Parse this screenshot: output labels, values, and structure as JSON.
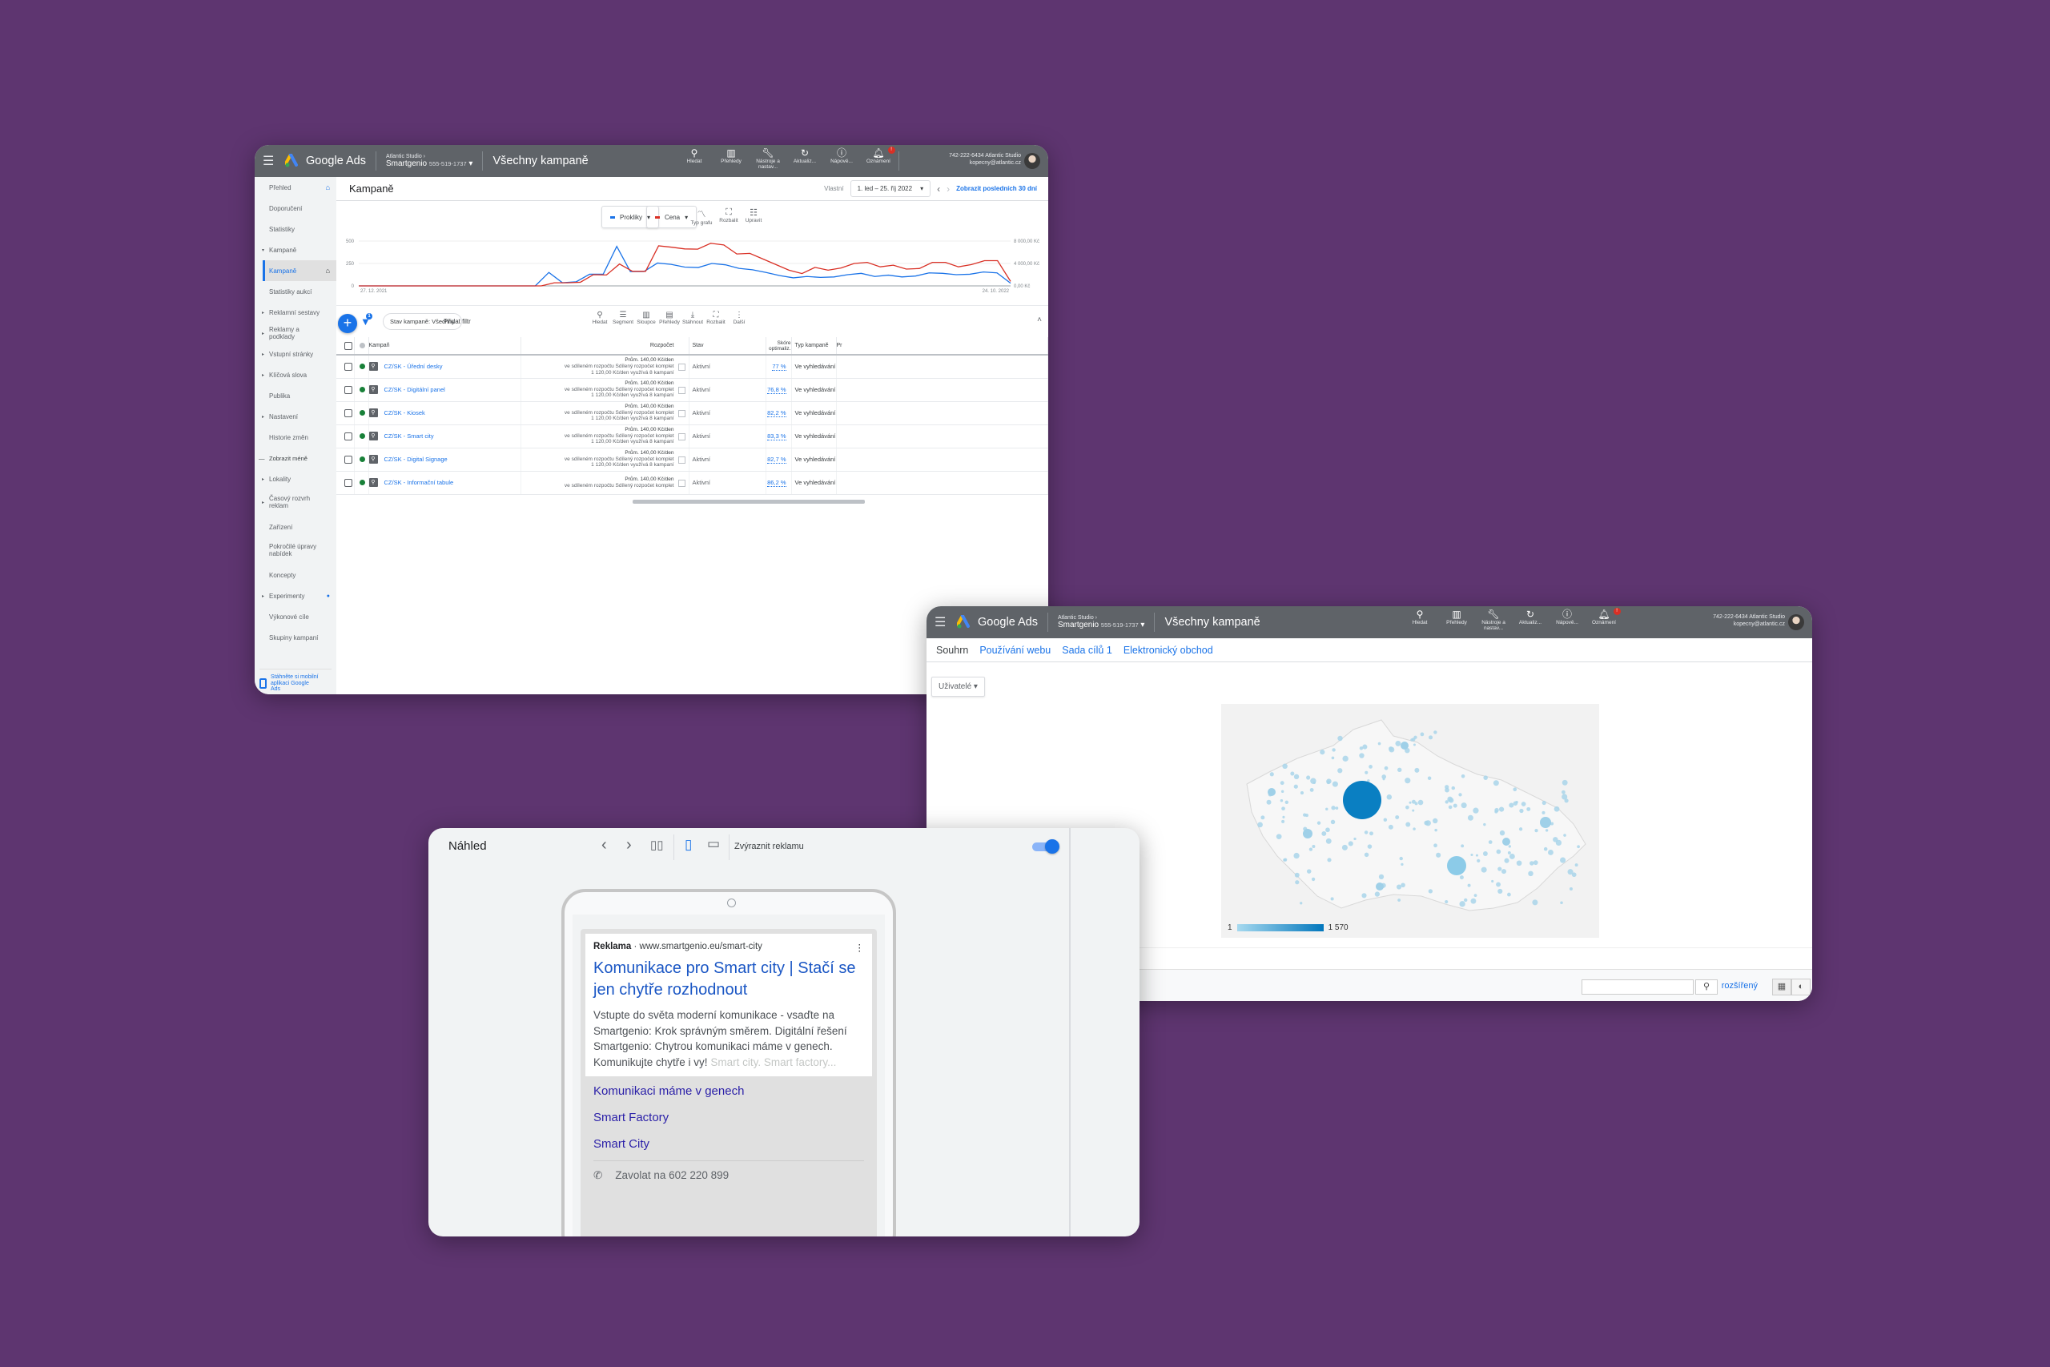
{
  "common": {
    "app_name": "Google Ads",
    "account_parent": "Atlantic Studio",
    "account_name": "Smartgenio",
    "account_id": "555-519-1737",
    "page_title": "Všechny kampaně",
    "toolbar": [
      {
        "icon": "search-icon",
        "label": "Hledat"
      },
      {
        "icon": "reports-icon",
        "label": "Přehledy"
      },
      {
        "icon": "wrench-icon",
        "label": "Nástroje a nastav..."
      },
      {
        "icon": "refresh-icon",
        "label": "Aktualiz..."
      },
      {
        "icon": "help-icon",
        "label": "Nápově..."
      },
      {
        "icon": "bell-icon",
        "label": "Oznámení",
        "badge": "!"
      }
    ],
    "user_line1": "742-222-6434 Atlantic Studio",
    "user_line2": "kopecny@atlantic.cz"
  },
  "campaigns_window": {
    "sidebar": [
      {
        "label": "Přehled",
        "type": "plain",
        "home": true
      },
      {
        "label": "Doporučení",
        "type": "plain"
      },
      {
        "label": "Statistiky",
        "type": "plain"
      },
      {
        "label": "Kampaně",
        "type": "exp"
      },
      {
        "label": "Kampaně",
        "type": "active",
        "home": true
      },
      {
        "label": "Statistiky aukcí",
        "type": "plain"
      },
      {
        "label": "Reklamní sestavy",
        "type": "sub"
      },
      {
        "label": "Reklamy a podklady",
        "type": "sub"
      },
      {
        "label": "Vstupní stránky",
        "type": "sub"
      },
      {
        "label": "Klíčová slova",
        "type": "sub"
      },
      {
        "label": "Publika",
        "type": "plain"
      },
      {
        "label": "Nastavení",
        "type": "sub"
      },
      {
        "label": "Historie změn",
        "type": "plain"
      },
      {
        "label": "Zobrazit méně",
        "type": "less"
      },
      {
        "label": "Lokality",
        "type": "sub"
      },
      {
        "label": "Časový rozvrh reklam",
        "type": "sub",
        "two": true
      },
      {
        "label": "Zařízení",
        "type": "plain"
      },
      {
        "label": "Pokročilé úpravy nabídek",
        "type": "plain",
        "two": true
      },
      {
        "label": "Koncepty",
        "type": "plain"
      },
      {
        "label": "Experimenty",
        "type": "sub",
        "dot": true
      },
      {
        "label": "Výkonové cíle",
        "type": "plain"
      },
      {
        "label": "Skupiny kampaní",
        "type": "plain"
      }
    ],
    "sidebar_app_promo": "Stáhněte si mobilní aplikaci Google Ads",
    "header_title": "Kampaně",
    "date_label": "Vlastní",
    "date_range": "1. led – 25. říj 2022",
    "last30_link": "Zobrazit posledních 30 dní",
    "metric1": {
      "label": "Prokliky",
      "color": "#1a73e8"
    },
    "metric2": {
      "label": "Cena",
      "color": "#d93025"
    },
    "chart_tools": [
      {
        "icon": "chart-type-icon",
        "label": "Typ grafu"
      },
      {
        "icon": "expand-icon",
        "label": "Rozbalit"
      },
      {
        "icon": "adjust-icon",
        "label": "Upravit"
      }
    ],
    "filter_count": "1",
    "filter_chip": "Stav kampaně: Všechny",
    "add_filter": "Přidat filtr",
    "table_tools": [
      {
        "icon": "search-icon",
        "label": "Hledat"
      },
      {
        "icon": "segment-icon",
        "label": "Segment"
      },
      {
        "icon": "columns-icon",
        "label": "Sloupce"
      },
      {
        "icon": "reports-icon",
        "label": "Přehledy"
      },
      {
        "icon": "download-icon",
        "label": "Stáhnout"
      },
      {
        "icon": "expand-icon",
        "label": "Rozbalit"
      },
      {
        "icon": "more-icon",
        "label": "Další"
      }
    ],
    "columns": {
      "campaign": "Kampaň",
      "budget": "Rozpočet",
      "status": "Stav",
      "opt_score": "Skóre optimaliz.",
      "type": "Typ kampaně",
      "next": "Pr"
    },
    "rows": [
      {
        "name": "CZ/SK - Úřední desky",
        "budget1": "Prům. 140,00 Kč/den",
        "budget2": "ve sdíleném rozpočtu Sdílený rozpočet komplet",
        "budget3": "1 120,00 Kč/den využívá 8 kampaní",
        "status": "Aktivní",
        "score": "77 %",
        "type": "Ve vyhledávání"
      },
      {
        "name": "CZ/SK - Digitální panel",
        "budget1": "Prům. 140,00 Kč/den",
        "budget2": "ve sdíleném rozpočtu Sdílený rozpočet komplet",
        "budget3": "1 120,00 Kč/den využívá 8 kampaní",
        "status": "Aktivní",
        "score": "76,8 %",
        "type": "Ve vyhledávání"
      },
      {
        "name": "CZ/SK - Kiosek",
        "budget1": "Prům. 140,00 Kč/den",
        "budget2": "ve sdíleném rozpočtu Sdílený rozpočet komplet",
        "budget3": "1 120,00 Kč/den využívá 8 kampaní",
        "status": "Aktivní",
        "score": "82,2 %",
        "type": "Ve vyhledávání"
      },
      {
        "name": "CZ/SK - Smart city",
        "budget1": "Prům. 140,00 Kč/den",
        "budget2": "ve sdíleném rozpočtu Sdílený rozpočet komplet",
        "budget3": "1 120,00 Kč/den využívá 8 kampaní",
        "status": "Aktivní",
        "score": "83,3 %",
        "type": "Ve vyhledávání"
      },
      {
        "name": "CZ/SK - Digital Signage",
        "budget1": "Prům. 140,00 Kč/den",
        "budget2": "ve sdíleném rozpočtu Sdílený rozpočet komplet",
        "budget3": "1 120,00 Kč/den využívá 8 kampaní",
        "status": "Aktivní",
        "score": "82,7 %",
        "type": "Ve vyhledávání"
      },
      {
        "name": "CZ/SK - Informační tabule",
        "budget1": "Prům. 140,00 Kč/den",
        "budget2": "ve sdíleném rozpočtu Sdílený rozpočet komplet",
        "budget3": "",
        "status": "Aktivní",
        "score": "86,2 %",
        "type": "Ve vyhledávání"
      }
    ]
  },
  "chart_data": {
    "type": "line",
    "title": "",
    "x_start_label": "27. 12. 2021",
    "x_end_label": "24. 10. 2022",
    "left_axis": {
      "ticks": [
        "0",
        "250",
        "500"
      ],
      "range": [
        0,
        500
      ]
    },
    "right_axis": {
      "ticks": [
        "0,00 Kč",
        "4 000,00 Kč",
        "8 000,00 Kč"
      ],
      "range": [
        0,
        8000
      ]
    },
    "points": 44,
    "series": [
      {
        "name": "Prokliky",
        "axis": "left",
        "color": "#1a73e8",
        "values": [
          0,
          0,
          0,
          0,
          0,
          0,
          0,
          0,
          0,
          0,
          0,
          0,
          0,
          0,
          150,
          35,
          45,
          130,
          130,
          440,
          160,
          160,
          255,
          240,
          210,
          205,
          250,
          235,
          195,
          180,
          150,
          115,
          90,
          105,
          95,
          100,
          125,
          140,
          105,
          120,
          100,
          110,
          145,
          140,
          125,
          130,
          155,
          145,
          30
        ]
      },
      {
        "name": "Cena",
        "axis": "right",
        "color": "#d93025",
        "values": [
          0,
          0,
          0,
          0,
          0,
          0,
          0,
          0,
          0,
          0,
          0,
          0,
          0,
          0,
          0,
          550,
          550,
          650,
          2000,
          1950,
          3900,
          2600,
          2600,
          7150,
          6900,
          6600,
          6550,
          7600,
          7300,
          5700,
          5800,
          4800,
          3800,
          2800,
          2200,
          3300,
          2800,
          3200,
          4000,
          4200,
          3400,
          3700,
          3000,
          3100,
          4200,
          4200,
          3400,
          3800,
          4500,
          4500,
          800
        ]
      }
    ]
  },
  "geo_window": {
    "tabs": [
      "Souhrn",
      "Používání webu",
      "Sada cílů 1",
      "Elektronický obchod"
    ],
    "active_tab": 0,
    "metric_dropdown": "Uživatelé",
    "legend_min": "1",
    "legend_max": "1 570",
    "search_placeholder": "",
    "advanced_link": "rozšířený"
  },
  "preview_window": {
    "title": "Náhled",
    "highlight_label": "Zvýraznit reklamu",
    "highlight_on": true,
    "ad": {
      "label": "Reklama",
      "url": "www.smartgenio.eu/smart-city",
      "headline": "Komunikace pro Smart city | Stačí se jen chytře rozhodnout",
      "description": "Vstupte do světa moderní komunikace - vsaďte na Smartgenio: Krok správným směrem. Digitální řešení Smartgenio: Chytrou komunikaci máme v genech. Komunikujte chytře i vy!",
      "description_faded": "Smart city. Smart factory...",
      "sitelinks": [
        "Komunikaci máme v genech",
        "Smart Factory",
        "Smart City"
      ],
      "call": "Zavolat na 602 220 899"
    }
  }
}
